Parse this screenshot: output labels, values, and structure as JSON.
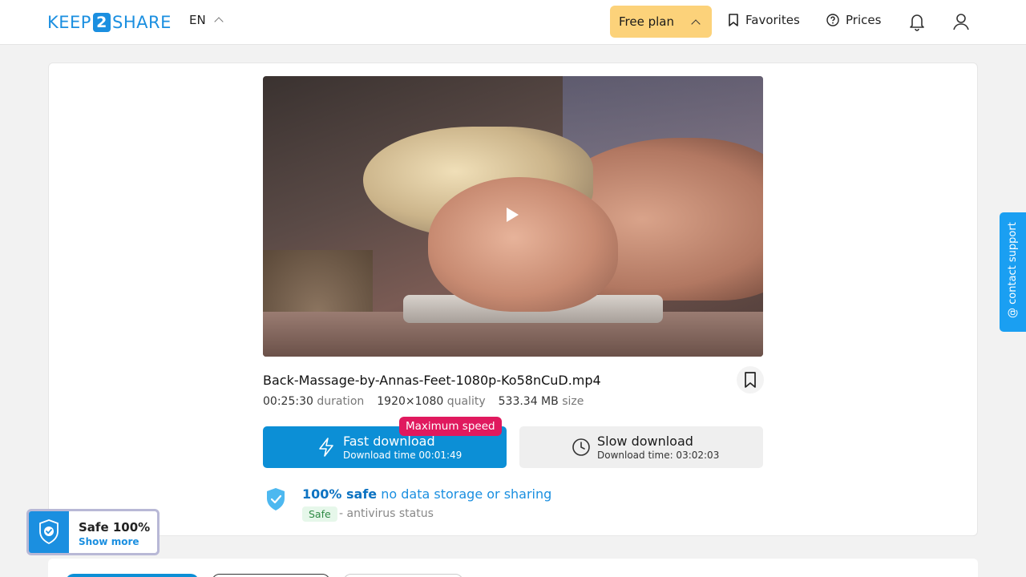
{
  "header": {
    "logo": {
      "left": "KEEP",
      "digit": "2",
      "right": "SHARE"
    },
    "language": "EN",
    "free_plan_label": "Free plan",
    "favorites_label": "Favorites",
    "prices_label": "Prices"
  },
  "file": {
    "name": "Back-Massage-by-Annas-Feet-1080p-Ko58nCuD.mp4",
    "duration_value": "00:25:30",
    "duration_label": "duration",
    "quality_value": "1920×1080",
    "quality_label": "quality",
    "size_value": "533.34 MB",
    "size_label": "size"
  },
  "downloads": {
    "fast": {
      "title": "Fast download",
      "subtitle": "Download time 00:01:49",
      "badge": "Maximum speed"
    },
    "slow": {
      "title": "Slow download",
      "subtitle": "Download time: 03:02:03"
    }
  },
  "safety": {
    "strong": "100% safe",
    "rest": "no data storage or sharing",
    "chip": "Safe",
    "status": "- antivirus status"
  },
  "support_tab": "@ contact support",
  "safe_widget": {
    "title": "Safe 100%",
    "link": "Show more"
  },
  "colors": {
    "accent": "#0c8fd6",
    "badge": "#e0195e",
    "plan": "#fcd27a"
  }
}
